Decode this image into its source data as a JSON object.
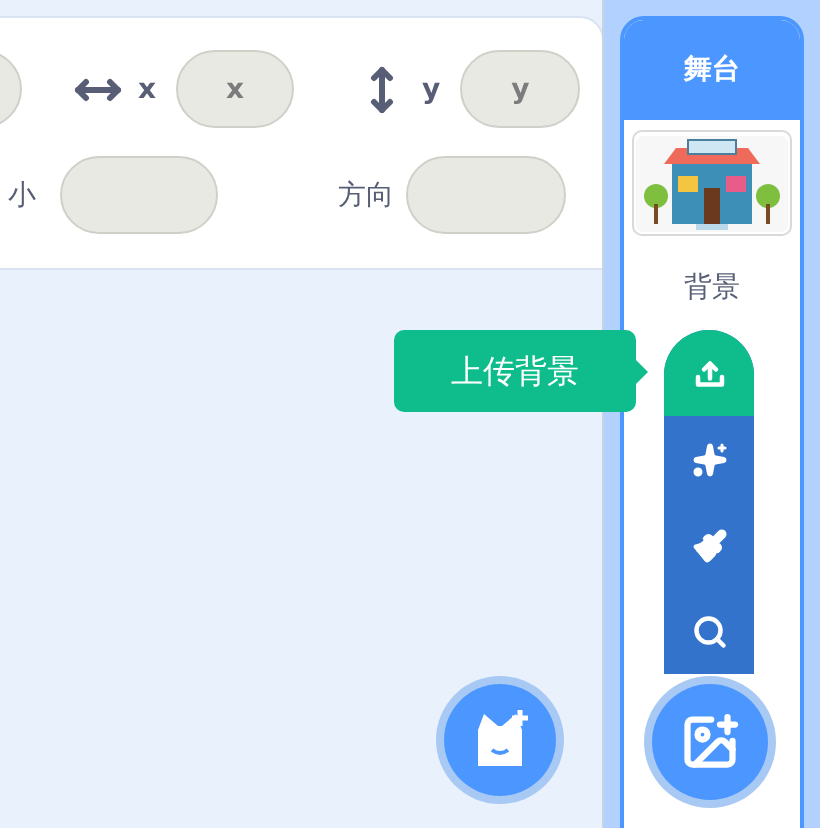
{
  "sprite_info": {
    "x_label": "x",
    "x_placeholder": "x",
    "y_label": "y",
    "y_placeholder": "y",
    "size_label": "小",
    "direction_label": "方向"
  },
  "stage": {
    "title": "舞台",
    "backdrop_label": "背景"
  },
  "backdrop_menu": {
    "tooltip": "上传背景",
    "items": [
      {
        "kind": "upload",
        "highlighted": true
      },
      {
        "kind": "surprise",
        "highlighted": false
      },
      {
        "kind": "paint",
        "highlighted": false
      },
      {
        "kind": "choose",
        "highlighted": false
      }
    ]
  }
}
